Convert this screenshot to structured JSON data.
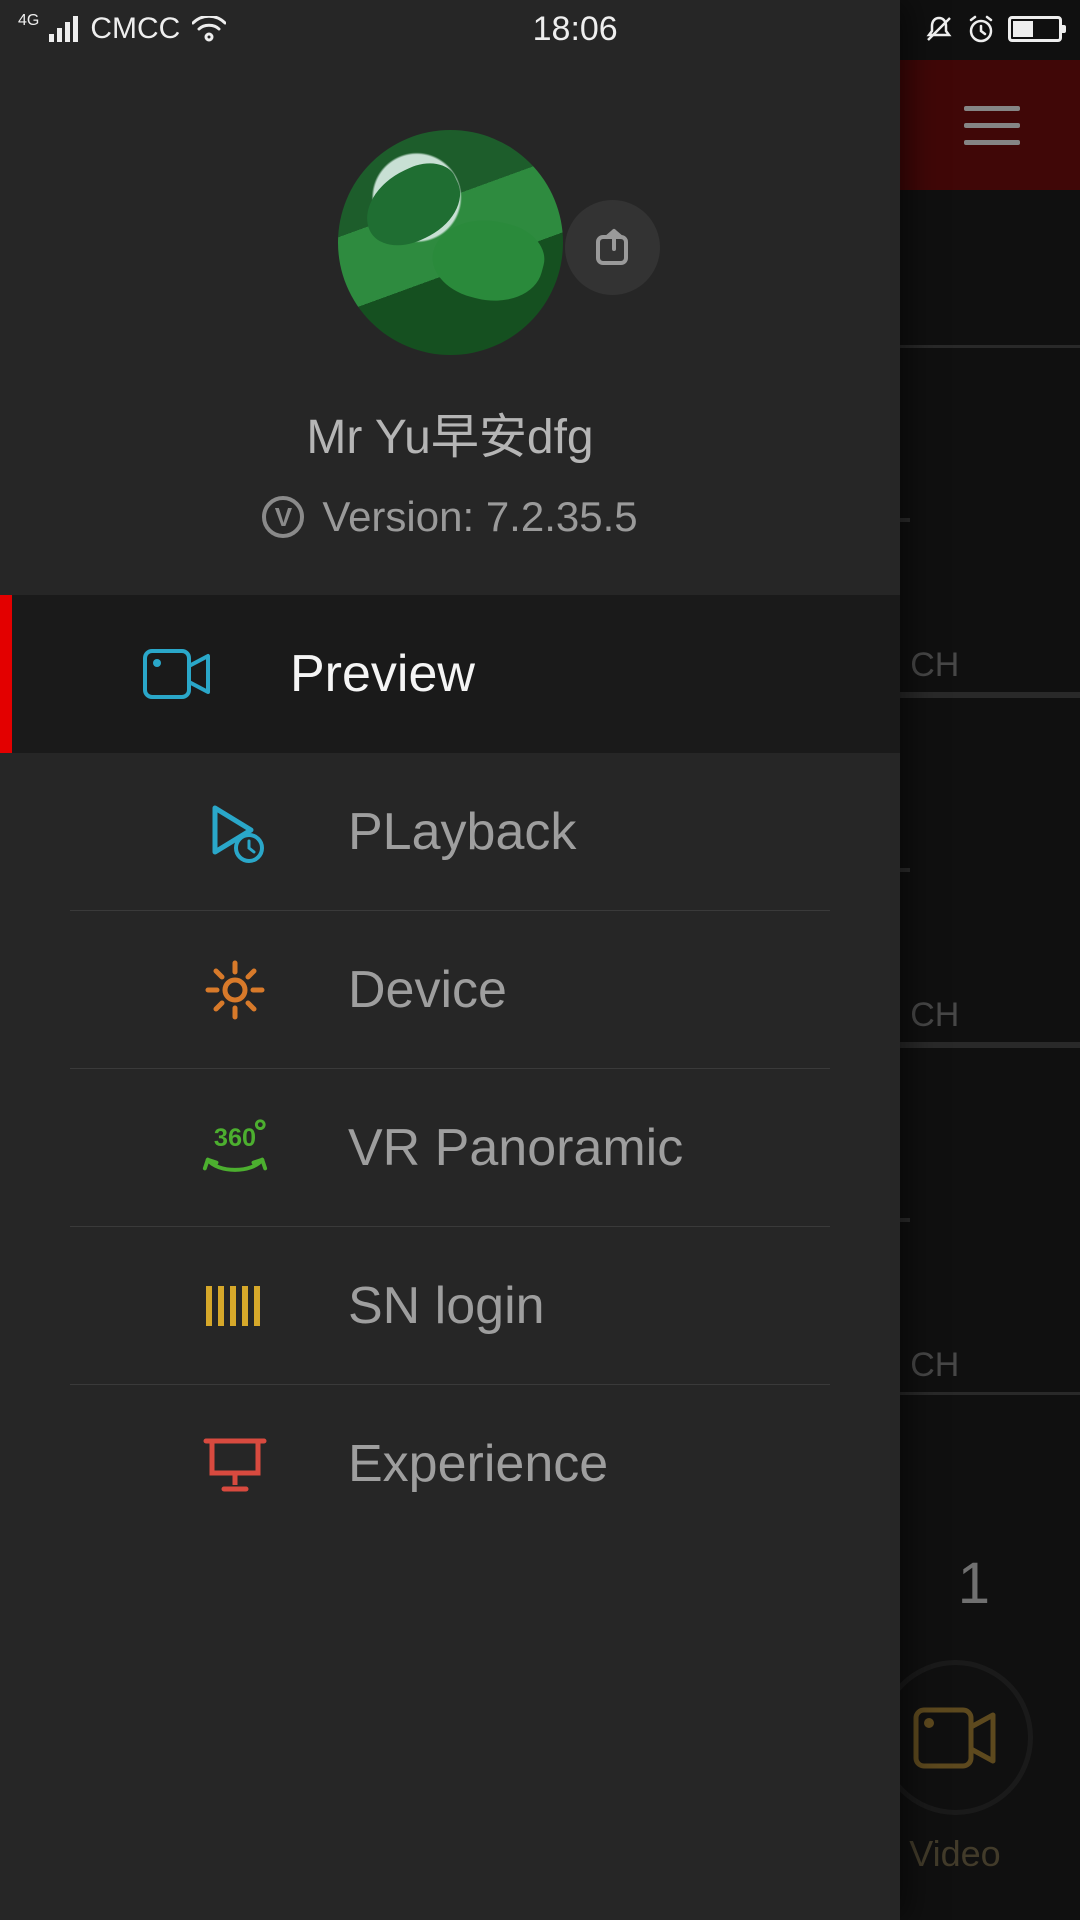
{
  "status": {
    "carrier": "CMCC",
    "time": "18:06",
    "network_badge": "4G"
  },
  "profile": {
    "username": "Mr Yu早安dfg",
    "version_prefix": "Version:",
    "version": "7.2.35.5"
  },
  "menu": {
    "items": [
      {
        "id": "preview",
        "label": "Preview",
        "active": true
      },
      {
        "id": "playback",
        "label": "PLayback",
        "active": false
      },
      {
        "id": "device",
        "label": "Device",
        "active": false
      },
      {
        "id": "vr",
        "label": "VR Panoramic",
        "active": false
      },
      {
        "id": "sn",
        "label": "SN login",
        "active": false
      },
      {
        "id": "experience",
        "label": "Experience",
        "active": false
      }
    ]
  },
  "background": {
    "slot_label": "Name, CH",
    "count": "1",
    "video_label": "Video"
  },
  "icons": {
    "share": "share-icon",
    "camera": "camera-icon"
  },
  "colors": {
    "accent_red": "#e30000",
    "header_red": "#6b0c0c",
    "preview_blue": "#2aa7c9",
    "device_orange": "#d87a2a",
    "vr_green": "#4caf2f",
    "sn_yellow": "#d6a82a",
    "experience_red": "#d84a3f",
    "video_gold": "#c79a3a"
  }
}
